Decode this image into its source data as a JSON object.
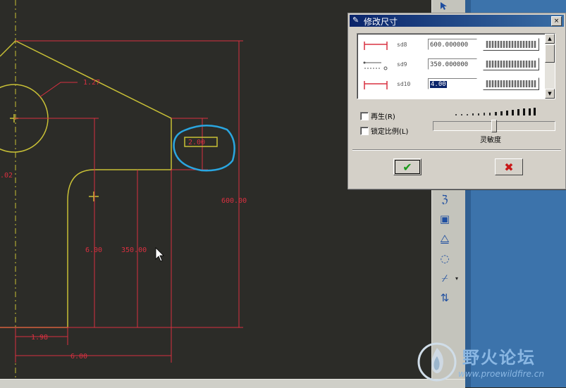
{
  "colors": {
    "drawing_bg": "#2c2c28",
    "geometry": "#c8c036",
    "dimension": "#d93040",
    "highlight": "#2aa6e0",
    "desktop": "#3c73ab"
  },
  "drawing": {
    "dimensions": [
      {
        "id": "radius",
        "text": "1.27"
      },
      {
        "id": "small-height",
        "text": "2.00"
      },
      {
        "id": "total-height",
        "text": "600.00"
      },
      {
        "id": "inner-height",
        "text": "6.00"
      },
      {
        "id": "mid-height",
        "text": "350.00"
      },
      {
        "id": "left-width",
        "text": "1.98"
      },
      {
        "id": "bottom-width",
        "text": "6.00"
      },
      {
        "id": "left-edge",
        "text": ".02"
      }
    ]
  },
  "dialog": {
    "title": "修改尺寸",
    "close": "×",
    "rows": [
      {
        "name": "sd8",
        "value": "600.000000",
        "icon": "horizontal-dimension-icon"
      },
      {
        "name": "sd9",
        "value": "350.000000",
        "icon": "leader-dimension-icon"
      },
      {
        "name": "sd10",
        "value": "4.00",
        "icon": "horizontal-dimension-icon"
      }
    ],
    "regenerate_label": "再生(R)",
    "lock_scale_label": "锁定比例(L)",
    "sensitivity_label": "灵敏度",
    "sensitivity_level": 0.5,
    "ok_icon": "checkmark-icon",
    "cancel_icon": "x-mark-icon"
  },
  "watermark": {
    "brand": "野火论坛",
    "url": "www.proewildfire.cn"
  }
}
